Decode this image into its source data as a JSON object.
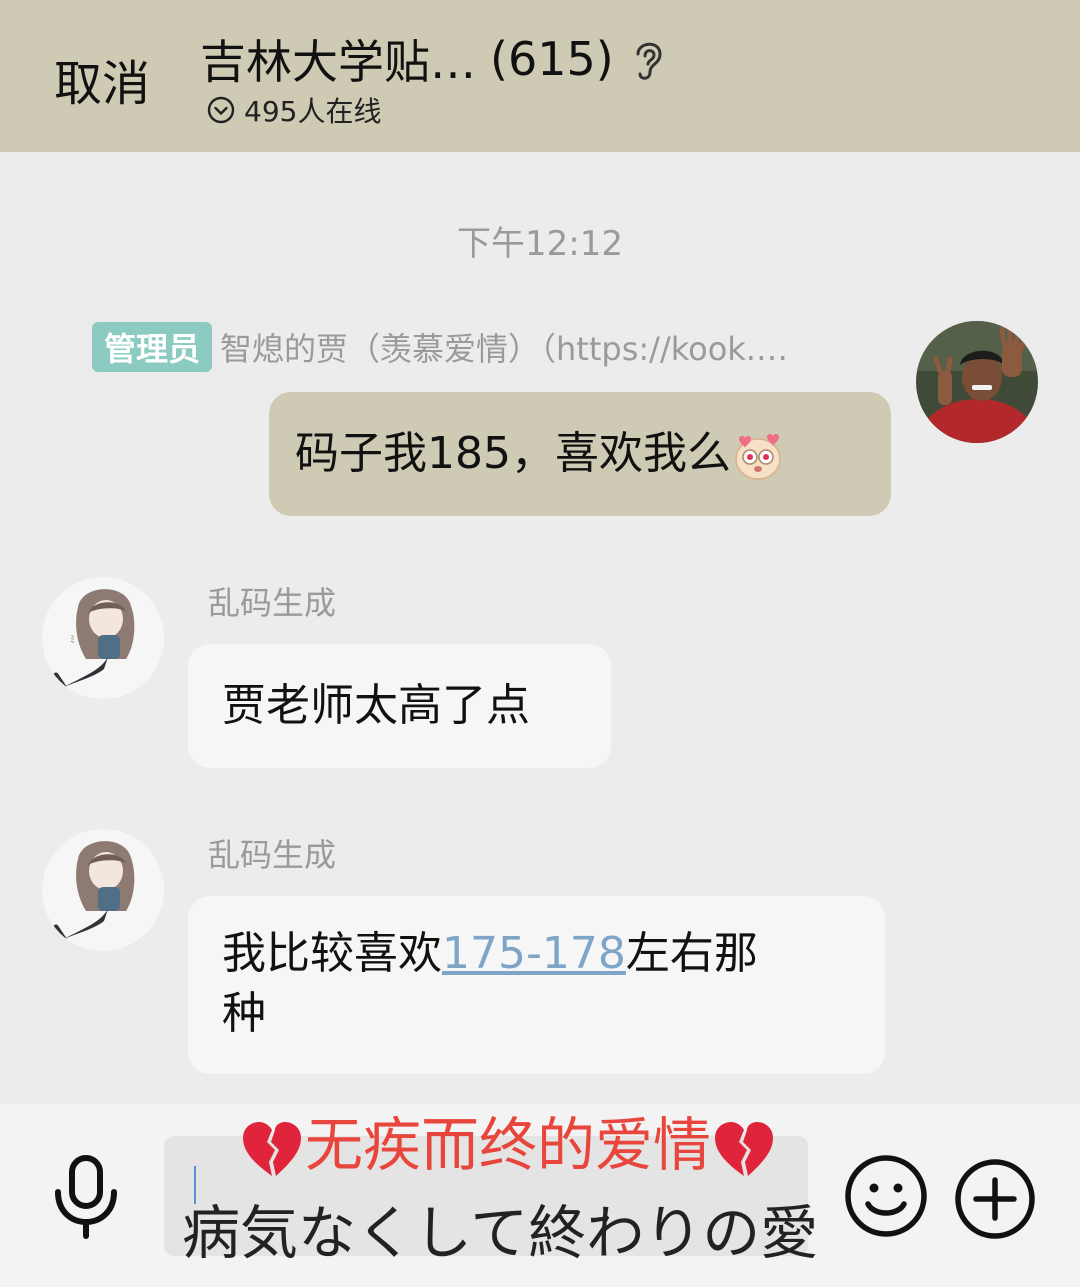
{
  "header": {
    "cancel_label": "取消",
    "title": "吉林大学贴…",
    "member_count": "(615)",
    "online_text": "495人在线"
  },
  "timestamp": "下午12:12",
  "messages": [
    {
      "admin_badge": "管理员",
      "sender": "智熄的贾（羡慕爱情）（https://kook.…",
      "text": "码子我185，喜欢我么"
    },
    {
      "sender": "乱码生成",
      "text": "贾老师太高了点"
    },
    {
      "sender": "乱码生成",
      "text_before": "我比较喜欢",
      "link_text": "175-178",
      "text_after_line1": "左右那",
      "text_after_line2": "种"
    }
  ],
  "caption": {
    "chinese": "无疾而终的爱情",
    "japanese": "病気なくして終わりの愛"
  },
  "colors": {
    "header_bg": "#cfcab4",
    "self_bubble": "#cfcab4",
    "other_bubble": "#f6f6f6",
    "admin_badge": "#8ccbc2",
    "link": "#7ea5c7",
    "caption_red": "#e8453c"
  },
  "icons": {
    "ear": "ear-icon",
    "online": "chevron-circle-icon",
    "mic": "microphone-icon",
    "emoji": "smiley-icon",
    "plus": "plus-circle-icon",
    "broken_heart": "broken-heart-icon"
  }
}
